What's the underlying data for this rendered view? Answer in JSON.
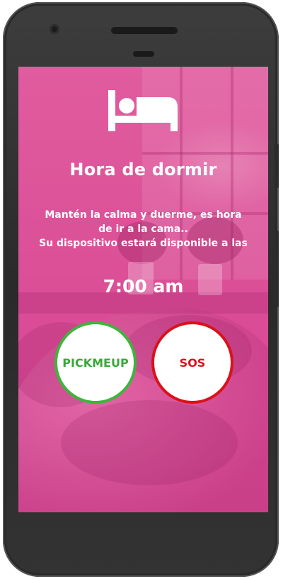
{
  "screen": {
    "icon": "bed-icon",
    "title": "Hora de dormir",
    "message_lines": [
      "Mantén la calma y duerme, es hora",
      "de ir a la cama..",
      "Su dispositivo estará disponible a las"
    ],
    "time": "7:00 am"
  },
  "buttons": {
    "pickmeup_label": "PICKMEUP",
    "sos_label": "SOS"
  },
  "colors": {
    "background": "#dc5198",
    "pickmeup_accent": "#3db53a",
    "sos_accent": "#d9121b",
    "text": "#ffffff"
  }
}
